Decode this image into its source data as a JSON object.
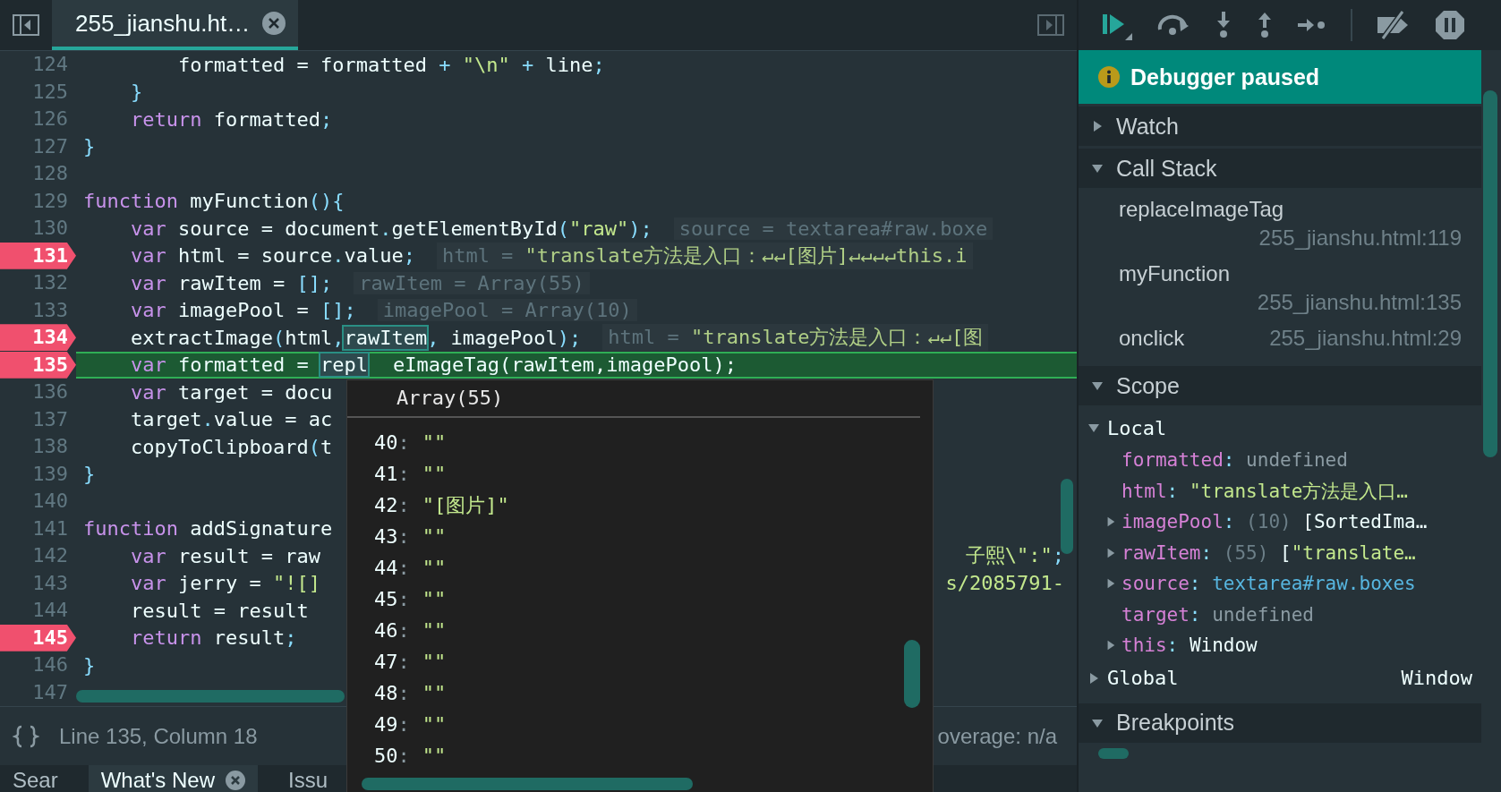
{
  "editor": {
    "file_tab": {
      "label": "255_jianshu.ht…",
      "selected": true
    },
    "lines": [
      {
        "number": "124",
        "breakpoint": false,
        "current": false,
        "tokens": [
          {
            "kind": "id",
            "text": "        formatted = formatted "
          },
          {
            "kind": "punc",
            "text": "+"
          },
          {
            "kind": "str",
            "text": " \"\\n\" "
          },
          {
            "kind": "punc",
            "text": "+"
          },
          {
            "kind": "id",
            "text": " line"
          },
          {
            "kind": "punc",
            "text": ";"
          }
        ]
      },
      {
        "number": "125",
        "breakpoint": false,
        "current": false,
        "tokens": [
          {
            "kind": "punc",
            "text": "    }"
          }
        ]
      },
      {
        "number": "126",
        "breakpoint": false,
        "current": false,
        "tokens": [
          {
            "kind": "kw",
            "text": "    return"
          },
          {
            "kind": "id",
            "text": " formatted"
          },
          {
            "kind": "punc",
            "text": ";"
          }
        ]
      },
      {
        "number": "127",
        "breakpoint": false,
        "current": false,
        "tokens": [
          {
            "kind": "punc",
            "text": "}"
          }
        ]
      },
      {
        "number": "128",
        "breakpoint": false,
        "current": false
      },
      {
        "number": "129",
        "breakpoint": false,
        "current": false,
        "tokens": [
          {
            "kind": "kw",
            "text": "function"
          },
          {
            "kind": "id",
            "text": " myFunction"
          },
          {
            "kind": "punc",
            "text": "(){"
          }
        ]
      },
      {
        "number": "130",
        "breakpoint": false,
        "current": false,
        "tokens": [
          {
            "kind": "kw",
            "text": "    var"
          },
          {
            "kind": "id",
            "text": " source = document"
          },
          {
            "kind": "punc",
            "text": "."
          },
          {
            "kind": "id",
            "text": "getElementById"
          },
          {
            "kind": "punc",
            "text": "("
          },
          {
            "kind": "str",
            "text": "\"raw\""
          },
          {
            "kind": "punc",
            "text": ");"
          }
        ],
        "inline": [
          {
            "kind": "dim",
            "text": "source = textarea#raw.boxe"
          }
        ]
      },
      {
        "number": "131",
        "breakpoint": true,
        "current": false,
        "tokens": [
          {
            "kind": "kw",
            "text": "    var"
          },
          {
            "kind": "id",
            "text": " html = source"
          },
          {
            "kind": "punc",
            "text": "."
          },
          {
            "kind": "id",
            "text": "value"
          },
          {
            "kind": "punc",
            "text": ";"
          }
        ],
        "inline": [
          {
            "kind": "dim",
            "text": "html = "
          },
          {
            "kind": "str",
            "text": "\"translate方法是入口：↵↵[图片]↵↵↵↵this.i"
          }
        ]
      },
      {
        "number": "132",
        "breakpoint": false,
        "current": false,
        "tokens": [
          {
            "kind": "kw",
            "text": "    var"
          },
          {
            "kind": "id",
            "text": " rawItem = "
          },
          {
            "kind": "punc",
            "text": "[];"
          }
        ],
        "inline": [
          {
            "kind": "dim",
            "text": "rawItem = Array(55)"
          }
        ]
      },
      {
        "number": "133",
        "breakpoint": false,
        "current": false,
        "tokens": [
          {
            "kind": "kw",
            "text": "    var"
          },
          {
            "kind": "id",
            "text": " imagePool = "
          },
          {
            "kind": "punc",
            "text": "[];"
          }
        ],
        "inline": [
          {
            "kind": "dim",
            "text": "imagePool = Array(10)"
          }
        ]
      },
      {
        "number": "134",
        "breakpoint": true,
        "current": false,
        "tokens": [
          {
            "kind": "id",
            "text": "    extractImage"
          },
          {
            "kind": "punc",
            "text": "("
          },
          {
            "kind": "id",
            "text": "html"
          },
          {
            "kind": "punc",
            "text": ","
          },
          {
            "kind": "hl",
            "text": "rawItem"
          },
          {
            "kind": "punc",
            "text": ","
          },
          {
            "kind": "id",
            "text": " imagePool"
          },
          {
            "kind": "punc",
            "text": ");"
          }
        ],
        "inline": [
          {
            "kind": "dim",
            "text": "html = "
          },
          {
            "kind": "str",
            "text": "\"translate方法是入口：↵↵[图"
          }
        ]
      },
      {
        "number": "135",
        "breakpoint": true,
        "current": true,
        "tokens": [
          {
            "kind": "kw",
            "text": "    var"
          },
          {
            "kind": "id",
            "text": " formatted = "
          },
          {
            "kind": "hl",
            "text": "repl"
          },
          {
            "kind": "after_gap",
            "text": "eImageTag(rawItem,imagePool);"
          }
        ]
      },
      {
        "number": "136",
        "breakpoint": false,
        "current": false,
        "tokens": [
          {
            "kind": "kw",
            "text": "    var"
          },
          {
            "kind": "id",
            "text": " target = docu"
          }
        ]
      },
      {
        "number": "137",
        "breakpoint": false,
        "current": false,
        "tokens": [
          {
            "kind": "id",
            "text": "    target"
          },
          {
            "kind": "punc",
            "text": "."
          },
          {
            "kind": "id",
            "text": "value = ac"
          }
        ]
      },
      {
        "number": "138",
        "breakpoint": false,
        "current": false,
        "tokens": [
          {
            "kind": "id",
            "text": "    copyToClipboard"
          },
          {
            "kind": "punc",
            "text": "("
          },
          {
            "kind": "id",
            "text": "t"
          }
        ]
      },
      {
        "number": "139",
        "breakpoint": false,
        "current": false,
        "tokens": [
          {
            "kind": "punc",
            "text": "}"
          }
        ]
      },
      {
        "number": "140",
        "breakpoint": false,
        "current": false
      },
      {
        "number": "141",
        "breakpoint": false,
        "current": false,
        "tokens": [
          {
            "kind": "kw",
            "text": "function"
          },
          {
            "kind": "id",
            "text": " addSignature"
          }
        ]
      },
      {
        "number": "142",
        "breakpoint": false,
        "current": false,
        "tokens": [
          {
            "kind": "kw",
            "text": "    var"
          },
          {
            "kind": "id",
            "text": " result = raw"
          }
        ],
        "right": [
          {
            "kind": "str",
            "text": "子熙\\\":\""
          },
          {
            "kind": "punc",
            "text": ";"
          }
        ]
      },
      {
        "number": "143",
        "breakpoint": false,
        "current": false,
        "tokens": [
          {
            "kind": "kw",
            "text": "    var"
          },
          {
            "kind": "id",
            "text": " jerry = "
          },
          {
            "kind": "str",
            "text": "\"![]"
          }
        ],
        "right": [
          {
            "kind": "str",
            "text": "s/2085791-"
          }
        ]
      },
      {
        "number": "144",
        "breakpoint": false,
        "current": false,
        "tokens": [
          {
            "kind": "id",
            "text": "    result = result"
          }
        ]
      },
      {
        "number": "145",
        "breakpoint": true,
        "current": false,
        "tokens": [
          {
            "kind": "kw",
            "text": "    return"
          },
          {
            "kind": "id",
            "text": " result"
          },
          {
            "kind": "punc",
            "text": ";"
          }
        ]
      },
      {
        "number": "146",
        "breakpoint": false,
        "current": false,
        "tokens": [
          {
            "kind": "punc",
            "text": "}"
          }
        ]
      },
      {
        "number": "147",
        "breakpoint": false,
        "current": false
      }
    ],
    "status_bar": {
      "position": "Line 135, Column 18",
      "coverage": "overage: n/a"
    }
  },
  "popover": {
    "title": "Array(55)",
    "items": [
      {
        "index": "40",
        "colon": ":",
        "value": "\"\""
      },
      {
        "index": "41",
        "colon": ":",
        "value": "\"\""
      },
      {
        "index": "42",
        "colon": ":",
        "value": "\"[图片]\""
      },
      {
        "index": "43",
        "colon": ":",
        "value": "\"\""
      },
      {
        "index": "44",
        "colon": ":",
        "value": "\"\""
      },
      {
        "index": "45",
        "colon": ":",
        "value": "\"\""
      },
      {
        "index": "46",
        "colon": ":",
        "value": "\"\""
      },
      {
        "index": "47",
        "colon": ":",
        "value": "\"\""
      },
      {
        "index": "48",
        "colon": ":",
        "value": "\"\""
      },
      {
        "index": "49",
        "colon": ":",
        "value": "\"\""
      },
      {
        "index": "50",
        "colon": ":",
        "value": "\"\""
      }
    ]
  },
  "drawer_tabs": [
    {
      "label": "Sear",
      "selected": false,
      "closable": false
    },
    {
      "label": "What's New",
      "selected": true,
      "closable": true
    },
    {
      "label": "Issu",
      "selected": false,
      "closable": false
    }
  ],
  "debugger": {
    "banner": "Debugger paused",
    "sections": [
      {
        "title": "Watch",
        "expanded": false
      },
      {
        "kind": "stack",
        "title": "Call Stack",
        "expanded": true,
        "frames": [
          {
            "name": "replaceImageTag",
            "location": "255_jianshu.html:119"
          },
          {
            "name": "myFunction",
            "location": "255_jianshu.html:135"
          },
          {
            "name": "onclick",
            "location": "255_jianshu.html:29"
          }
        ]
      },
      {
        "kind": "scope",
        "title": "Scope",
        "expanded": true,
        "scopes": [
          {
            "name": "Local",
            "expanded": true,
            "vars": [
              {
                "name": "formatted",
                "expandable": false,
                "value": [
                  {
                    "kind": "punc",
                    "text": ": "
                  },
                  {
                    "kind": "undef",
                    "text": "undefined"
                  }
                ]
              },
              {
                "name": "html",
                "expandable": false,
                "value": [
                  {
                    "kind": "punc",
                    "text": ": "
                  },
                  {
                    "kind": "str",
                    "text": "\"translate方法是入口…"
                  }
                ]
              },
              {
                "name": "imagePool",
                "expandable": true,
                "value": [
                  {
                    "kind": "punc",
                    "text": ": "
                  },
                  {
                    "kind": "count",
                    "text": "(10)"
                  },
                  {
                    "kind": "id",
                    "text": " [SortedIma…"
                  }
                ]
              },
              {
                "name": "rawItem",
                "expandable": true,
                "value": [
                  {
                    "kind": "punc",
                    "text": ": "
                  },
                  {
                    "kind": "count",
                    "text": "(55)"
                  },
                  {
                    "kind": "id",
                    "text": " ["
                  },
                  {
                    "kind": "str",
                    "text": "\"translate…"
                  }
                ]
              },
              {
                "name": "source",
                "expandable": true,
                "value": [
                  {
                    "kind": "punc",
                    "text": ": "
                  },
                  {
                    "kind": "node",
                    "text": "textarea#raw.boxes"
                  }
                ]
              },
              {
                "name": "target",
                "expandable": false,
                "value": [
                  {
                    "kind": "punc",
                    "text": ": "
                  },
                  {
                    "kind": "undef",
                    "text": "undefined"
                  }
                ]
              },
              {
                "name": "this",
                "expandable": true,
                "value": [
                  {
                    "kind": "punc",
                    "text": ": "
                  },
                  {
                    "kind": "id",
                    "text": "Window"
                  }
                ]
              }
            ]
          },
          {
            "name": "Global",
            "expanded": false,
            "summary": "Window"
          }
        ]
      },
      {
        "title": "Breakpoints",
        "expanded": true
      }
    ]
  }
}
